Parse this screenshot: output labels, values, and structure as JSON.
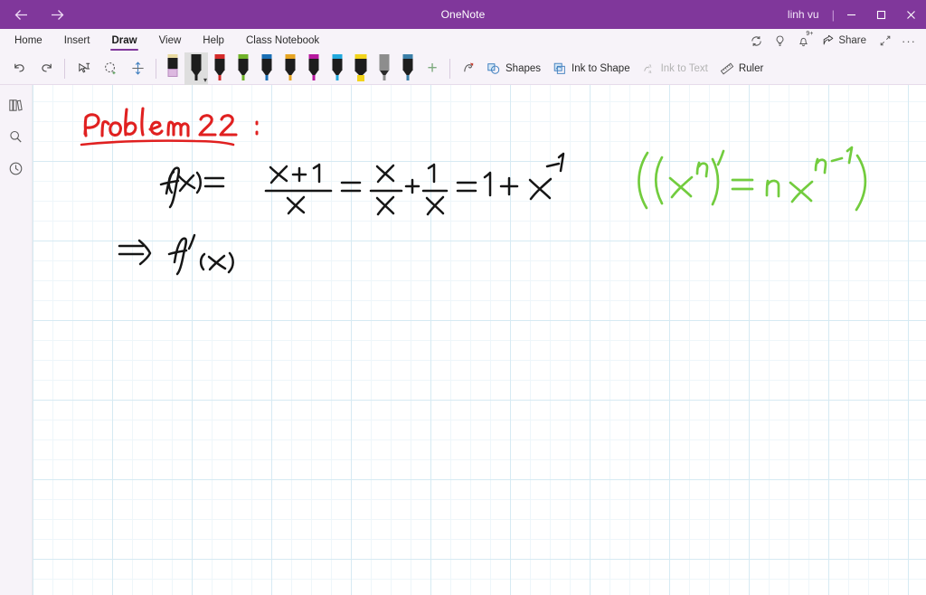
{
  "titlebar": {
    "app_title": "OneNote",
    "user": "linh vu",
    "separator": "|",
    "back_label": "Back",
    "forward_label": "Forward",
    "minimize_label": "Minimize",
    "maximize_label": "Restore",
    "close_label": "Close",
    "bg_color": "#80379b"
  },
  "ribbon": {
    "tabs": [
      {
        "label": "Home",
        "active": false
      },
      {
        "label": "Insert",
        "active": false
      },
      {
        "label": "Draw",
        "active": true
      },
      {
        "label": "View",
        "active": false
      },
      {
        "label": "Help",
        "active": false
      },
      {
        "label": "Class Notebook",
        "active": false
      }
    ],
    "active_tab": "Draw",
    "accent_color": "#80379b",
    "right_items": [
      {
        "name": "sync-icon",
        "label": "Sync"
      },
      {
        "name": "lightbulb-icon",
        "label": "Tell me what you want to do"
      },
      {
        "name": "notifications-bell-icon",
        "label": "Notifications",
        "badge": "9+"
      },
      {
        "name": "share-icon",
        "label": "Share"
      },
      {
        "name": "expand-icon",
        "label": "Full screen"
      },
      {
        "name": "more-options-icon",
        "label": "···"
      }
    ],
    "share_label": "Share",
    "more_label": "···"
  },
  "toolbar": {
    "undo_label": "Undo",
    "redo_label": "Redo",
    "lasso_label": "Lasso Select",
    "select_label": "Select",
    "insert_space_label": "Insert Space",
    "pens": [
      {
        "name": "eraser",
        "label": "Eraser",
        "color": "#dcb8e0",
        "cap": "#e8d9a0",
        "type": "eraser",
        "selected": false
      },
      {
        "name": "pen-black",
        "label": "Black Pen",
        "color": "#1d1d1d",
        "cap": "#1d1d1d",
        "type": "pen",
        "selected": true
      },
      {
        "name": "pen-red",
        "label": "Red Pen",
        "color": "#d42a2a",
        "cap": "#d42a2a",
        "type": "pen",
        "selected": false
      },
      {
        "name": "pen-green",
        "label": "Green Pen",
        "color": "#70b229",
        "cap": "#70b229",
        "type": "pen",
        "selected": false
      },
      {
        "name": "pen-blue",
        "label": "Blue Pen",
        "color": "#1a6fb5",
        "cap": "#1a6fb5",
        "type": "pen",
        "selected": false
      },
      {
        "name": "pen-orange",
        "label": "Orange Pen",
        "color": "#e6a422",
        "cap": "#e6a422",
        "type": "pen",
        "selected": false
      },
      {
        "name": "pen-magenta",
        "label": "Magenta Pen",
        "color": "#b7189f",
        "cap": "#b7189f",
        "type": "pen",
        "selected": false
      },
      {
        "name": "pen-cyan",
        "label": "Light Blue Pen",
        "color": "#22a9dd",
        "cap": "#22a9dd",
        "type": "pen",
        "selected": false
      },
      {
        "name": "highlighter-yellow",
        "label": "Yellow Highlighter",
        "color": "#f2d31b",
        "cap": "#f2d31b",
        "type": "highlighter",
        "selected": false
      },
      {
        "name": "pencil-gray",
        "label": "Pencil",
        "color": "#8d8d8d",
        "cap": "#8d8d8d",
        "type": "pencil",
        "selected": false
      },
      {
        "name": "pen-steel-blue",
        "label": "Steel Blue Pen",
        "color": "#3b7fa8",
        "cap": "#3b7fa8",
        "type": "pen",
        "selected": false
      }
    ],
    "add_pen_label": "+",
    "ink_replay_label": "Ink Replay",
    "shapes_label": "Shapes",
    "ink_to_shape_label": "Ink to Shape",
    "ink_to_text_label": "Ink to Text",
    "ink_to_text_disabled": true,
    "ruler_label": "Ruler"
  },
  "sidebar": {
    "items": [
      {
        "name": "notebooks-icon",
        "label": "Notebooks"
      },
      {
        "name": "search-icon",
        "label": "Search"
      },
      {
        "name": "recent-notes-icon",
        "label": "Recent Notes"
      }
    ]
  },
  "canvas": {
    "grid_color": "#d6eaf3",
    "grid_minor_color": "#eef6fa",
    "background": "#ffffff",
    "ink_notes": [
      {
        "name": "heading-problem-22",
        "text": "Problem 22 :",
        "color": "#e02020",
        "underlined": true
      },
      {
        "name": "equation-line-1",
        "text": "f(x) = (x+1)/x = x/x + 1/x = 1 + x^-1",
        "color": "#1a1a1a"
      },
      {
        "name": "rule-note-power-rule",
        "text": "((x^n)' = n x^(n-1))",
        "color": "#6fcc3a"
      },
      {
        "name": "equation-line-2",
        "text": "=) f'(x)",
        "color": "#1a1a1a"
      }
    ]
  }
}
